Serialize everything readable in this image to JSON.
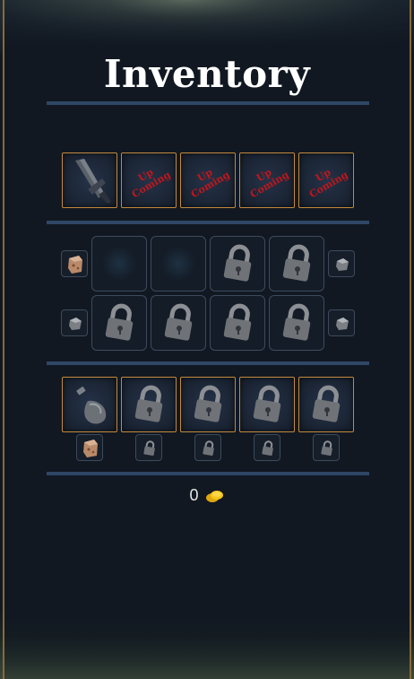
{
  "title": "Inventory",
  "equipment_row": {
    "weapon_slot": "sword-icon",
    "upcoming_label": "Up Coming",
    "upcoming_slots": [
      "Up Coming",
      "Up Coming",
      "Up Coming",
      "Up Coming"
    ]
  },
  "bag_rows": [
    {
      "left_item": "copper-ore-icon",
      "slots": [
        "empty",
        "empty",
        "locked",
        "locked"
      ],
      "right_item": "stone-icon"
    },
    {
      "left_item": "stone-icon",
      "slots": [
        "locked",
        "locked",
        "locked",
        "locked"
      ],
      "right_item": "stone-icon"
    }
  ],
  "consumable_row": {
    "slots": [
      "potion",
      "locked",
      "locked",
      "locked",
      "locked"
    ],
    "sub_items": [
      "copper-ore-icon",
      "lock-icon",
      "lock-icon",
      "lock-icon",
      "lock-icon"
    ]
  },
  "currency": {
    "amount": "0",
    "icon": "gold-coins-icon"
  },
  "colors": {
    "gold_border": "#c48a3e",
    "divider": "#2f4767",
    "upcoming_text": "#c0161b",
    "background": "#111822"
  }
}
